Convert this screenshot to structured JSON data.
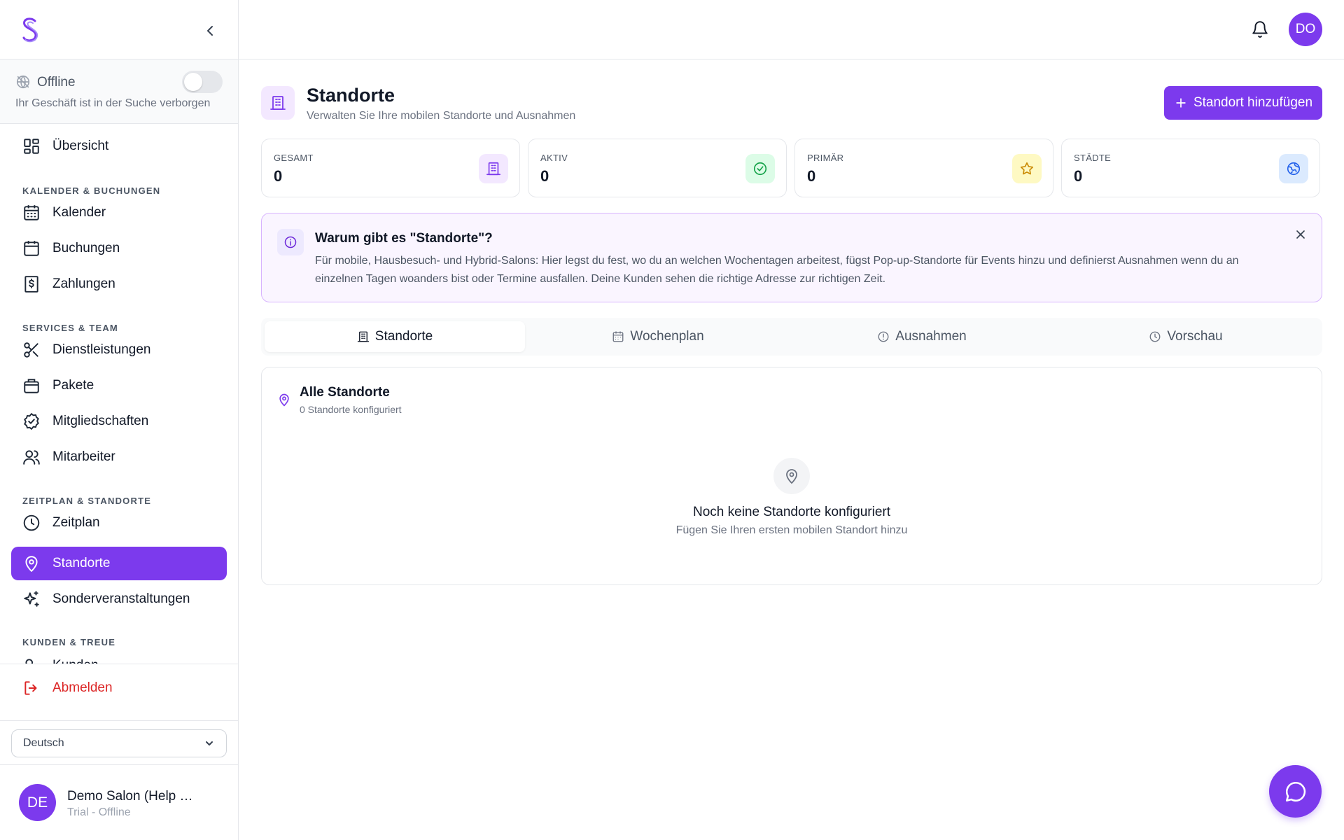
{
  "sidebar": {
    "offline": {
      "label": "Offline",
      "subtitle": "Ihr Geschäft ist in der Suche verborgen",
      "enabled": false
    },
    "nav": {
      "overview": "Übersicht",
      "section_calendar": "KALENDER & BUCHUNGEN",
      "calendar": "Kalender",
      "bookings": "Buchungen",
      "payments": "Zahlungen",
      "section_services": "SERVICES & TEAM",
      "services": "Dienstleistungen",
      "packages": "Pakete",
      "memberships": "Mitgliedschaften",
      "staff": "Mitarbeiter",
      "section_schedule": "ZEITPLAN & STANDORTE",
      "schedule": "Zeitplan",
      "locations": "Standorte",
      "special_events": "Sonderveranstaltungen",
      "section_customers": "KUNDEN & TREUE",
      "customers": "Kunden"
    },
    "logout": "Abmelden",
    "language": "Deutsch",
    "user": {
      "initials": "DE",
      "name": "Demo Salon (Help …",
      "status": "Trial - Offline"
    }
  },
  "topbar": {
    "avatar_initials": "DO"
  },
  "page": {
    "title": "Standorte",
    "subtitle": "Verwalten Sie Ihre mobilen Standorte und Ausnahmen",
    "add_button": "Standort hinzufügen"
  },
  "stats": [
    {
      "label": "GESAMT",
      "value": "0"
    },
    {
      "label": "AKTIV",
      "value": "0"
    },
    {
      "label": "PRIMÄR",
      "value": "0"
    },
    {
      "label": "STÄDTE",
      "value": "0"
    }
  ],
  "info": {
    "title": "Warum gibt es \"Standorte\"?",
    "text": "Für mobile, Hausbesuch- und Hybrid-Salons: Hier legst du fest, wo du an welchen Wochentagen arbeitest, fügst Pop-up-Standorte für Events hinzu und definierst Ausnahmen wenn du an einzelnen Tagen woanders bist oder Termine ausfallen. Deine Kunden sehen die richtige Adresse zur richtigen Zeit."
  },
  "tabs": [
    "Standorte",
    "Wochenplan",
    "Ausnahmen",
    "Vorschau"
  ],
  "panel": {
    "title": "Alle Standorte",
    "subtitle": "0 Standorte konfiguriert",
    "empty_title": "Noch keine Standorte konfiguriert",
    "empty_subtitle": "Fügen Sie Ihren ersten mobilen Standort hinzu"
  },
  "colors": {
    "accent": "#7c3aed",
    "danger": "#dc2626"
  }
}
